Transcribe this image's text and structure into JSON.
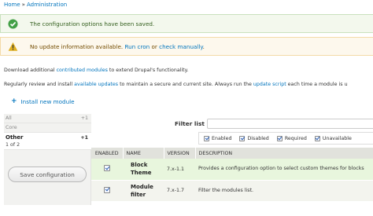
{
  "breadcrumb": {
    "home": "Home",
    "separator": "»",
    "current": "Administration"
  },
  "messages": {
    "status": {
      "text": "The configuration options have been saved."
    },
    "warning": {
      "prefix": "No update information available. ",
      "link1": "Run cron",
      "middle": " or ",
      "link2": "check manually",
      "suffix": "."
    }
  },
  "help": {
    "line1_a": "Download additional ",
    "line1_link": "contributed modules",
    "line1_b": " to extend Drupal's functionality.",
    "line2_a": "Regularly review and install ",
    "line2_link1": "available updates",
    "line2_b": " to maintain a secure and current site. Always run the ",
    "line2_link2": "update script",
    "line2_c": " each time a module is u"
  },
  "install_link": {
    "plus": "+",
    "label": "Install new module"
  },
  "tabs": [
    {
      "label": "All",
      "count": "+1"
    },
    {
      "label": "Core",
      "count": ""
    },
    {
      "label": "Other",
      "sub": "1 of 2",
      "count": "+1"
    }
  ],
  "save_button": "Save configuration",
  "filter": {
    "label": "Filter list",
    "value": "",
    "options": [
      "Enabled",
      "Disabled",
      "Required",
      "Unavailable"
    ]
  },
  "table": {
    "headers": [
      "ENABLED",
      "NAME",
      "VERSION",
      "DESCRIPTION"
    ],
    "rows": [
      {
        "name_line1": "Block",
        "name_line2": "Theme",
        "version": "7.x-1.1",
        "description": "Provides a configuration option to select custom themes for blocks"
      },
      {
        "name_line1": "Module",
        "name_line2": "filter",
        "version": "7.x-1.7",
        "description": "Filter the modules list."
      }
    ]
  },
  "colors": {
    "link": "#0074bd",
    "status_bg": "#f3f8ed",
    "warning_bg": "#fdf8ed",
    "enabled_row": "#e8f6dd"
  }
}
